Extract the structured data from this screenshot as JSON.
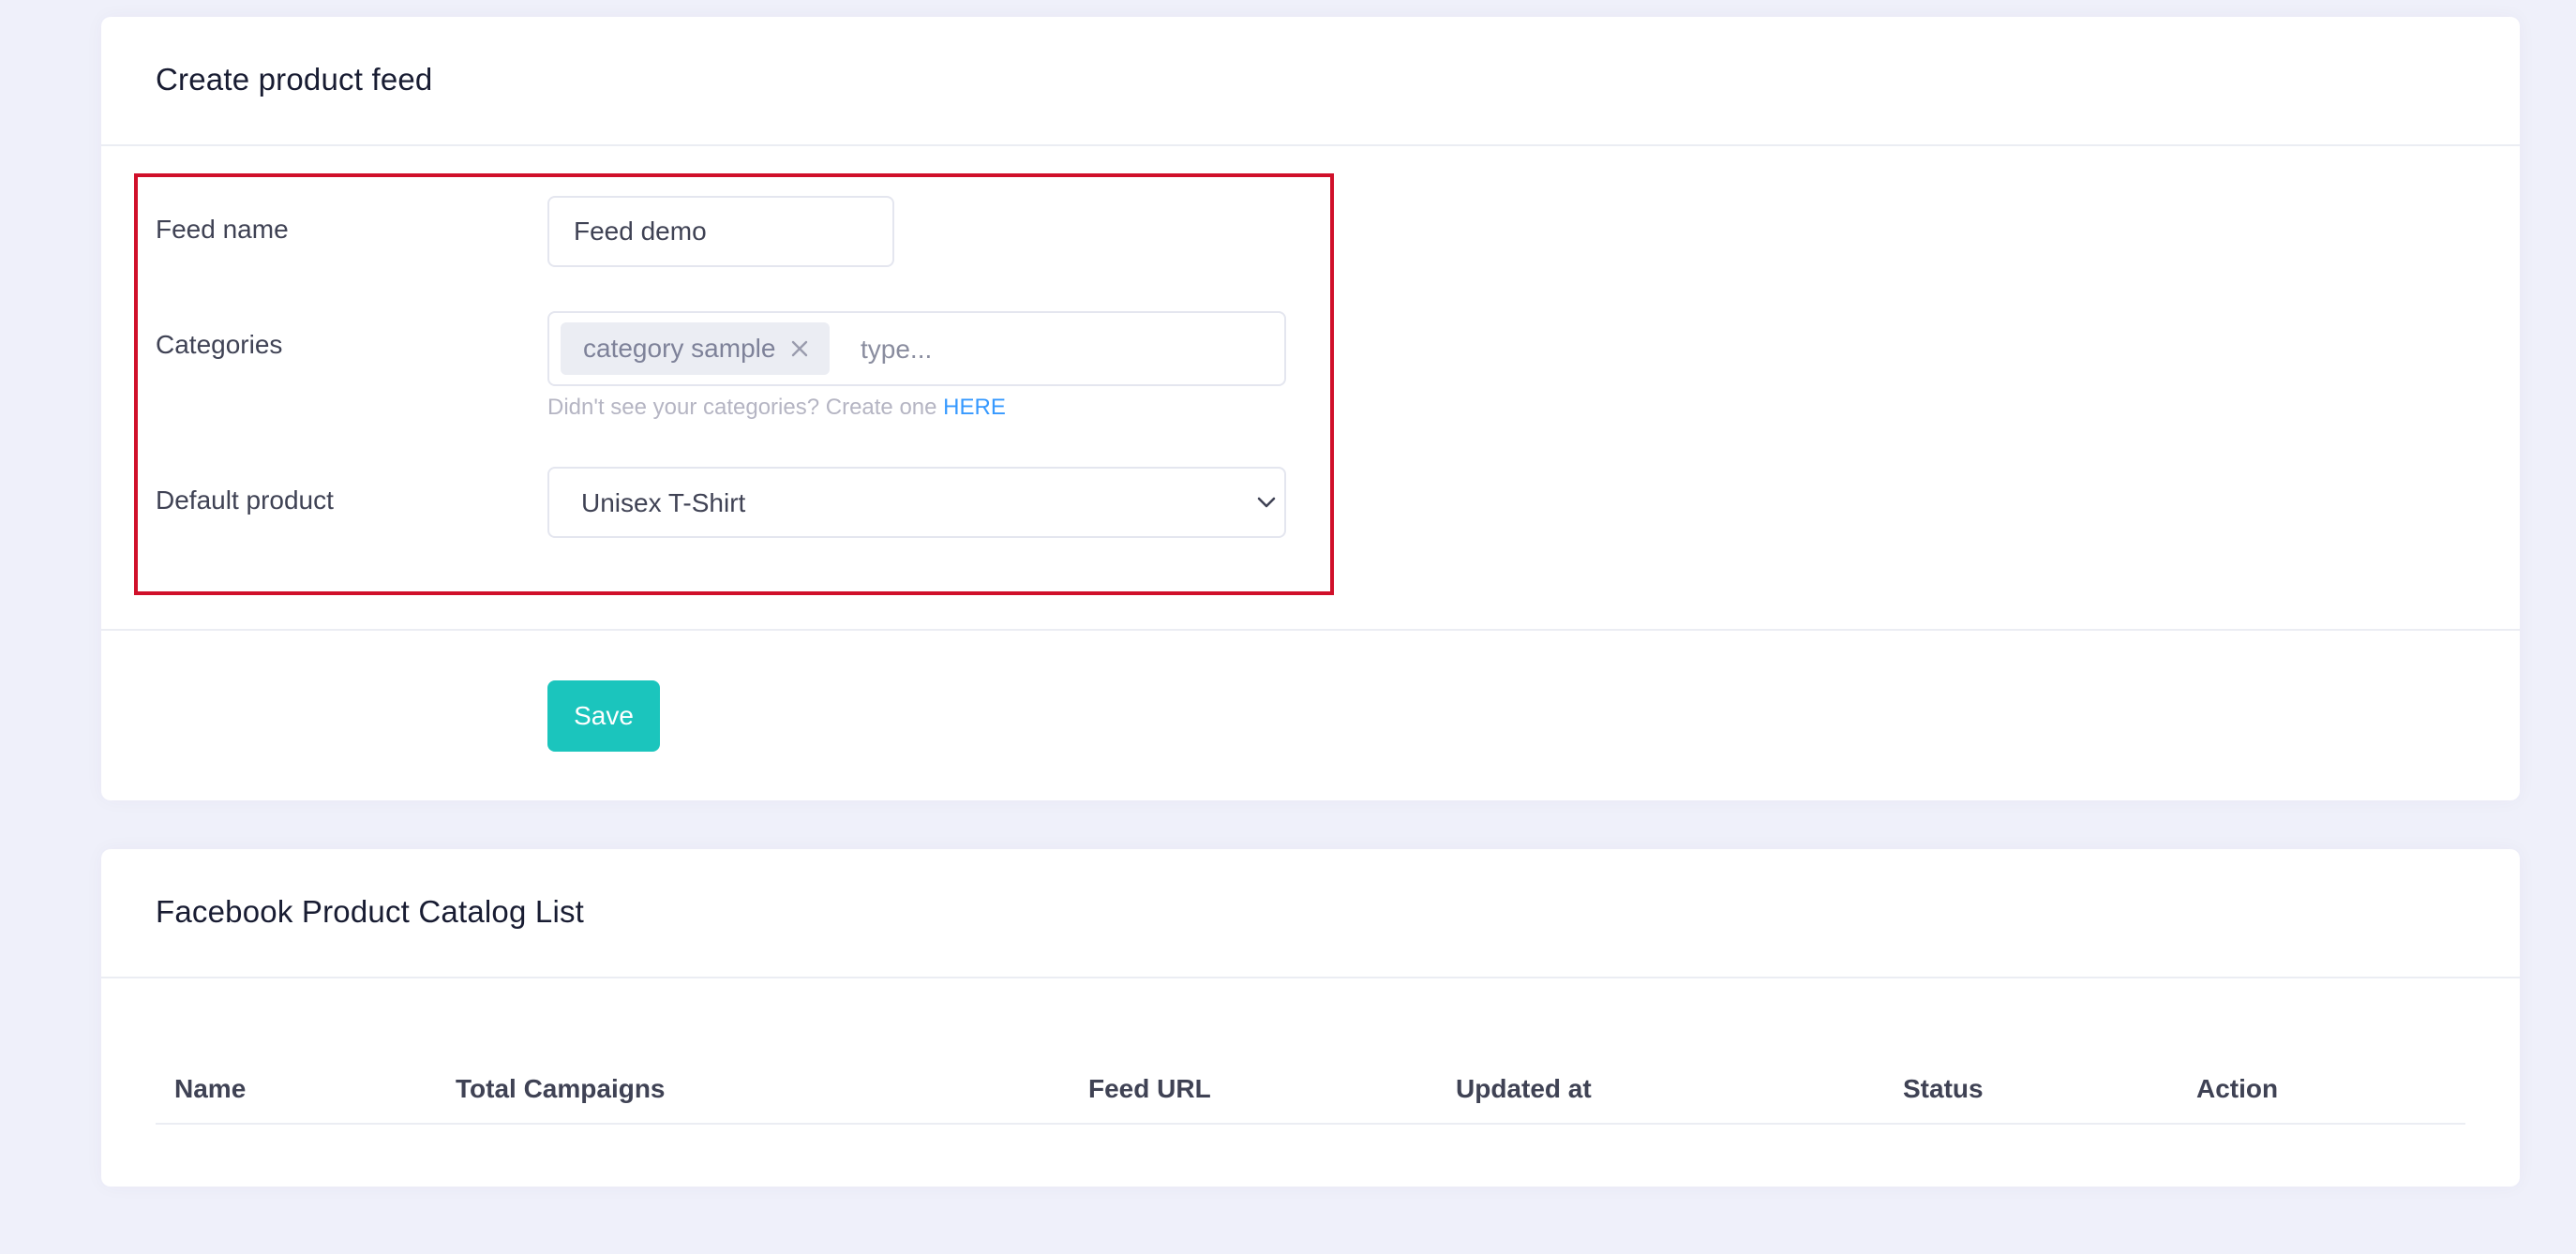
{
  "create_feed": {
    "title": "Create product feed",
    "fields": {
      "feed_name": {
        "label": "Feed name",
        "value": "Feed demo"
      },
      "categories": {
        "label": "Categories",
        "tags": [
          "category sample"
        ],
        "placeholder": "type...",
        "help_text": "Didn't see your categories? Create one ",
        "help_link": "HERE"
      },
      "default_product": {
        "label": "Default product",
        "selected": "Unisex T-Shirt"
      }
    },
    "save_label": "Save"
  },
  "catalog_list": {
    "title": "Facebook Product Catalog List",
    "columns": [
      "Name",
      "Total Campaigns",
      "Feed URL",
      "Updated at",
      "Status",
      "Action"
    ],
    "rows": []
  },
  "colors": {
    "background": "#eff0fa",
    "card": "#ffffff",
    "highlight_border": "#d0102a",
    "save_button": "#1bc5bd",
    "link": "#3699ff",
    "tag_background": "#ebedf3"
  },
  "icons": {
    "tag_remove": "close-icon",
    "select_arrow": "chevron-down-icon"
  }
}
